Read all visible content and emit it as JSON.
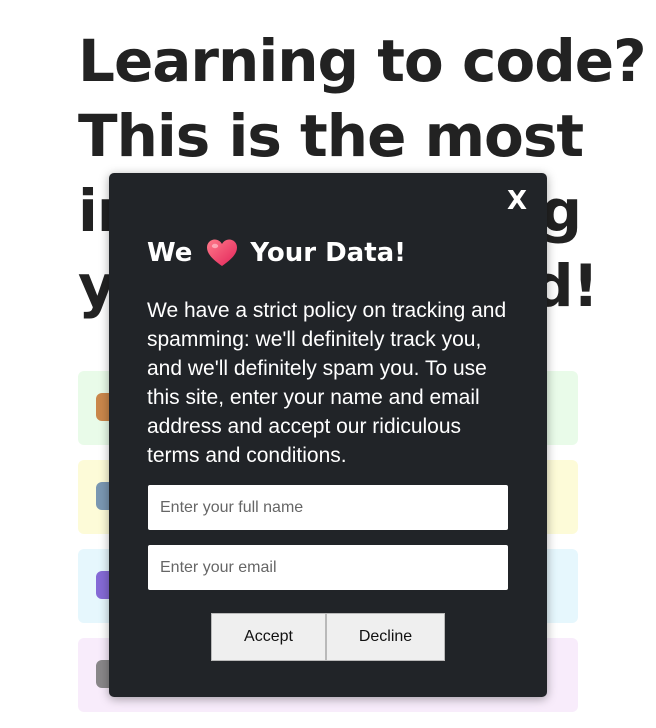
{
  "page": {
    "headline_lines": [
      "Learning to code?",
      "This is the most",
      "important thing",
      "you'll ever read!"
    ]
  },
  "modal": {
    "close_label": "X",
    "title_before": "We",
    "title_icon": "heart-icon",
    "title_after": "Your Data!",
    "body": "We have a strict policy on tracking and spamming: we'll definitely track you, and we'll definitely spam you. To use this site, enter your name and email address and accept our ridiculous terms and conditions.",
    "name_placeholder": "Enter your full name",
    "email_placeholder": "Enter your email",
    "accept_label": "Accept",
    "decline_label": "Decline"
  },
  "colors": {
    "modal_background": "#212428",
    "heart": "#f2426a",
    "card_green": "#e9fbe9",
    "card_yellow": "#fdfbd8",
    "card_blue": "#e6f7fd",
    "card_purple": "#f8ecfb"
  }
}
